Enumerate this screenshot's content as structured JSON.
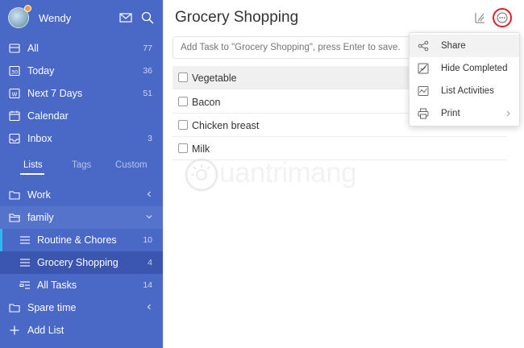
{
  "user": {
    "name": "Wendy"
  },
  "smart_lists": [
    {
      "label": "All",
      "count": "77",
      "icon": "inbox-stack-icon"
    },
    {
      "label": "Today",
      "count": "36",
      "icon": "calendar-30-icon"
    },
    {
      "label": "Next 7 Days",
      "count": "51",
      "icon": "calendar-w-icon"
    },
    {
      "label": "Calendar",
      "count": "",
      "icon": "calendar-icon"
    },
    {
      "label": "Inbox",
      "count": "3",
      "icon": "inbox-icon"
    }
  ],
  "tabs": {
    "lists": "Lists",
    "tags": "Tags",
    "custom": "Custom"
  },
  "folders": {
    "work": "Work",
    "family": "family",
    "routine": {
      "label": "Routine & Chores",
      "count": "10"
    },
    "grocery": {
      "label": "Grocery Shopping",
      "count": "4"
    },
    "all_tasks": {
      "label": "All Tasks",
      "count": "14"
    },
    "spare": "Spare time",
    "add_list": "Add List"
  },
  "main": {
    "title": "Grocery Shopping",
    "add_task_placeholder": "Add Task to \"Grocery Shopping\", press Enter to save.",
    "tasks": [
      "Vegetable",
      "Bacon",
      "Chicken breast",
      "Milk"
    ]
  },
  "menu": {
    "share": "Share",
    "hide_completed": "Hide Completed",
    "list_activities": "List Activities",
    "print": "Print"
  },
  "watermark": "uantrimang",
  "colors": {
    "sidebar": "#4a68c6",
    "sidebar_active": "#3a56ae",
    "accent": "#32b6f0",
    "highlight_ring": "#e21b2b"
  }
}
